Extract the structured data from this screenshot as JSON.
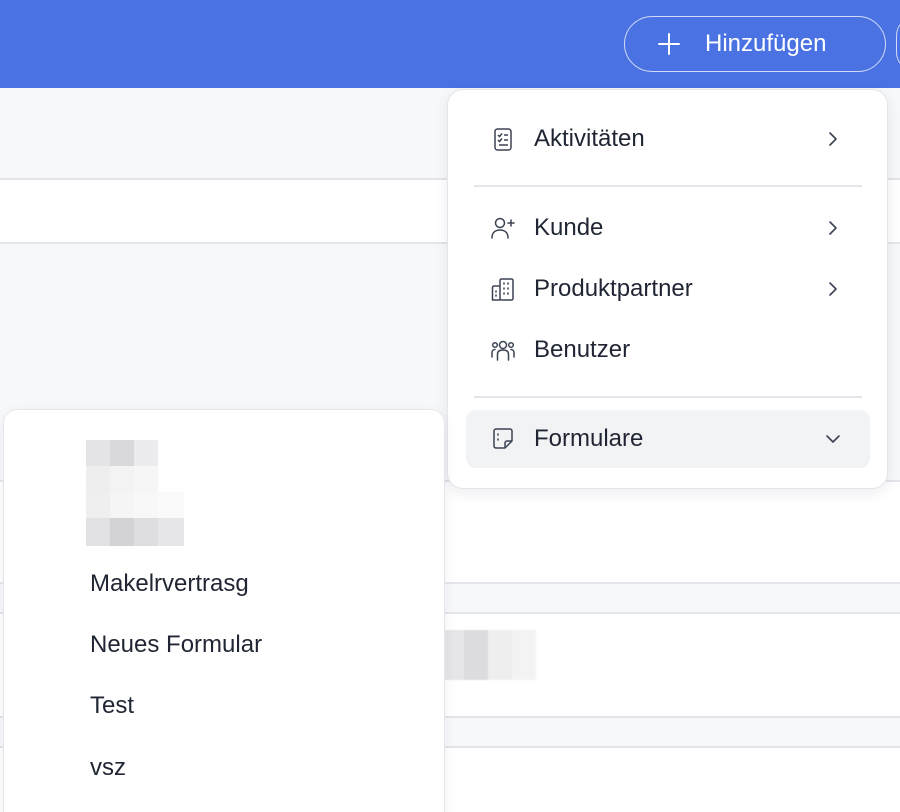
{
  "header": {
    "add_button_label": "Hinzufügen",
    "accent_color": "#4a72e3"
  },
  "menu": {
    "items": [
      {
        "label": "Aktivitäten",
        "icon": "checklist-icon",
        "has_submenu": true
      },
      {
        "label": "Kunde",
        "icon": "user-plus-icon",
        "has_submenu": true
      },
      {
        "label": "Produktpartner",
        "icon": "buildings-icon",
        "has_submenu": true
      },
      {
        "label": "Benutzer",
        "icon": "users-group-icon",
        "has_submenu": false
      },
      {
        "label": "Formulare",
        "icon": "form-note-icon",
        "expanded": true
      }
    ]
  },
  "forms_submenu": {
    "items": [
      {
        "label": "Makelrvertrasg"
      },
      {
        "label": "Neues Formular"
      },
      {
        "label": "Test"
      },
      {
        "label": "vsz"
      }
    ]
  }
}
